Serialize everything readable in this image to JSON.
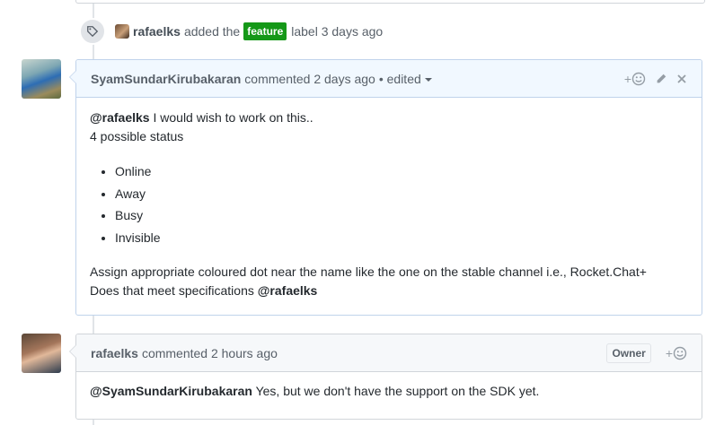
{
  "label_event": {
    "author": "rafaelks",
    "action": "added the",
    "label": "feature",
    "label_color": "#159818",
    "suffix": "label 3 days ago",
    "icon": "tag-icon"
  },
  "comments": [
    {
      "author": "SyamSundarKirubakaran",
      "meta": "commented 2 days ago",
      "edited": "• edited",
      "body": {
        "mention": "@rafaelks",
        "line1_rest": " I would wish to work on this..",
        "line2": "4 possible status",
        "statuses": [
          "Online",
          "Away",
          "Busy",
          "Invisible"
        ],
        "para2_line1": "Assign appropriate coloured dot near the name like the one on the stable channel i.e., Rocket.Chat+",
        "para2_line2_prefix": "Does that meet specifications ",
        "para2_line2_mention": "@rafaelks"
      },
      "actions": {
        "reaction": "+",
        "icons": [
          "smiley-icon",
          "pencil-icon",
          "close-icon"
        ]
      }
    },
    {
      "author": "rafaelks",
      "meta": "commented 2 hours ago",
      "badge": "Owner",
      "body": {
        "mention": "@SyamSundarKirubakaran",
        "rest": " Yes, but we don't have the support on the SDK yet."
      },
      "actions": {
        "reaction": "+",
        "icons": [
          "smiley-icon"
        ]
      }
    }
  ]
}
